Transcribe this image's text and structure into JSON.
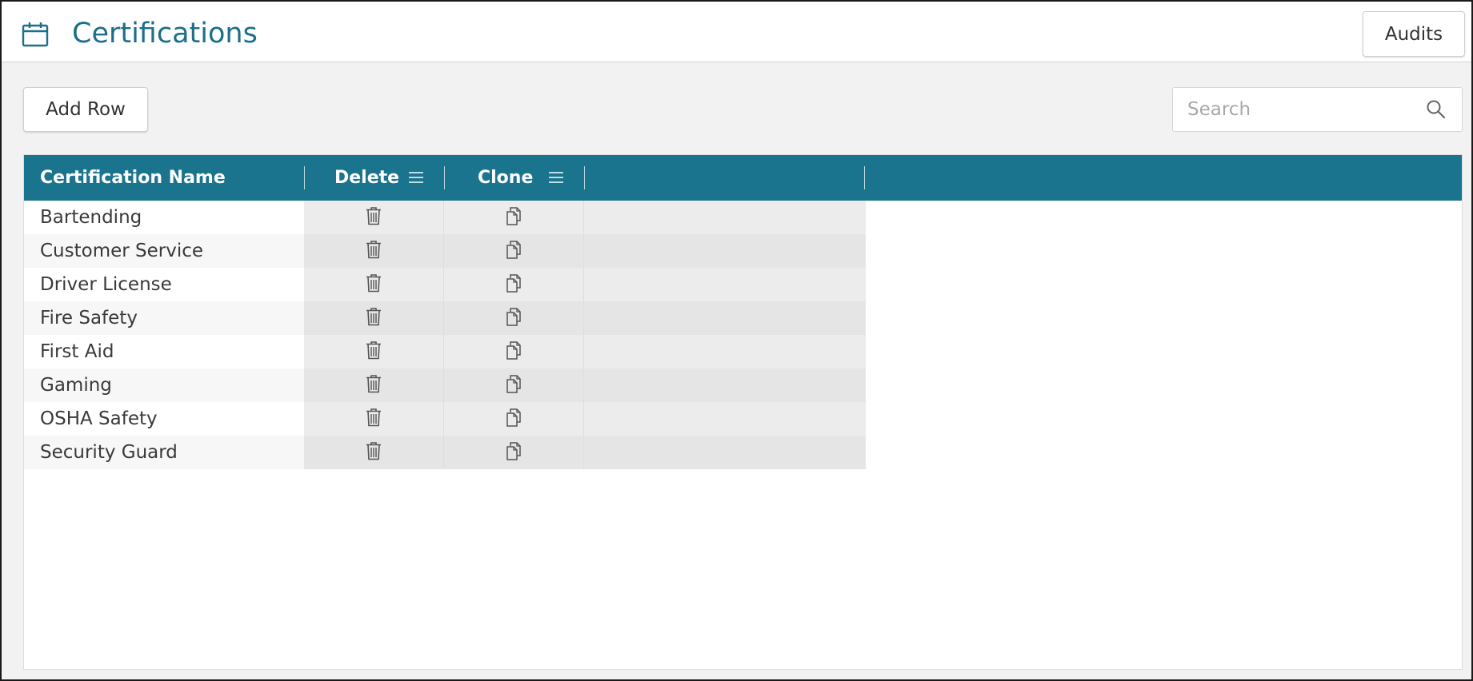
{
  "header": {
    "title": "Certifications",
    "icon": "calendar-icon",
    "audits_label": "Audits"
  },
  "toolbar": {
    "add_row_label": "Add Row",
    "search_placeholder": "Search",
    "search_value": ""
  },
  "grid": {
    "columns": {
      "name": "Certification Name",
      "delete": "Delete",
      "clone": "Clone"
    },
    "rows": [
      {
        "name": "Bartending"
      },
      {
        "name": "Customer Service"
      },
      {
        "name": "Driver License"
      },
      {
        "name": "Fire Safety"
      },
      {
        "name": "First Aid"
      },
      {
        "name": "Gaming"
      },
      {
        "name": "OSHA Safety"
      },
      {
        "name": "Security Guard"
      }
    ]
  },
  "colors": {
    "header_bar": "#1b748d",
    "title_text": "#1b6f8a",
    "background": "#f2f2f2"
  }
}
